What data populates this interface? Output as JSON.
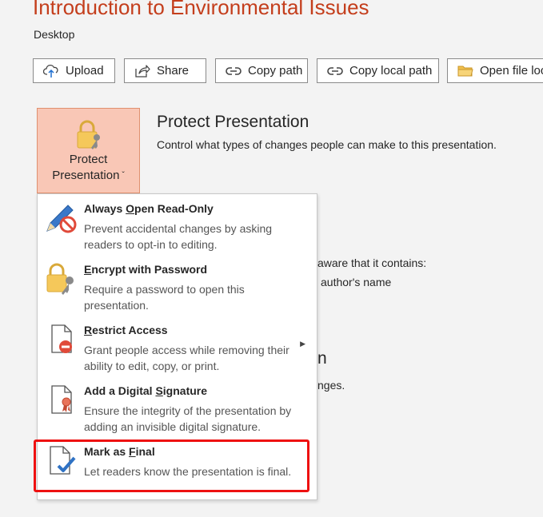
{
  "header": {
    "title": "Introduction to Environmental Issues",
    "location": "Desktop"
  },
  "toolbar": [
    {
      "label": "Upload",
      "icon": "upload-icon"
    },
    {
      "label": "Share",
      "icon": "share-icon"
    },
    {
      "label": "Copy path",
      "icon": "link-icon"
    },
    {
      "label": "Copy local path",
      "icon": "link-icon"
    },
    {
      "label": "Open file loc",
      "icon": "folder-icon"
    }
  ],
  "protect": {
    "button_label_1": "Protect",
    "button_label_2": "Presentation",
    "chevron": "ˇ",
    "title": "Protect Presentation",
    "description": "Control what types of changes people can make to this presentation."
  },
  "background_text": {
    "inspect_line1": "aware that it contains:",
    "inspect_line2": "author's name",
    "heading_fragment": "n",
    "changes_fragment": "nges."
  },
  "menu": {
    "items": [
      {
        "title_pre": "Always ",
        "title_key": "O",
        "title_post": "pen Read-Only",
        "description": "Prevent accidental changes by asking readers to opt-in to editing.",
        "icon": "pencil-no-edit-icon",
        "has_submenu": false
      },
      {
        "title_pre": "",
        "title_key": "E",
        "title_post": "ncrypt with Password",
        "description": "Require a password to open this presentation.",
        "icon": "lock-key-icon",
        "has_submenu": false
      },
      {
        "title_pre": "",
        "title_key": "R",
        "title_post": "estrict Access",
        "description": "Grant people access while removing their ability to edit, copy, or print.",
        "icon": "restricted-document-icon",
        "has_submenu": true
      },
      {
        "title_pre": "Add a Digital ",
        "title_key": "S",
        "title_post": "ignature",
        "description": "Ensure the integrity of the presentation by adding an invisible digital signature.",
        "icon": "signature-document-icon",
        "has_submenu": false
      },
      {
        "title_pre": "Mark as ",
        "title_key": "F",
        "title_post": "inal",
        "description": "Let readers know the presentation is final.",
        "icon": "final-document-icon",
        "has_submenu": false
      }
    ],
    "submenu_arrow": "▶"
  },
  "colors": {
    "accent": "#c43e1c",
    "highlight": "#ee1111",
    "protect_fill": "#f9c7b6"
  }
}
